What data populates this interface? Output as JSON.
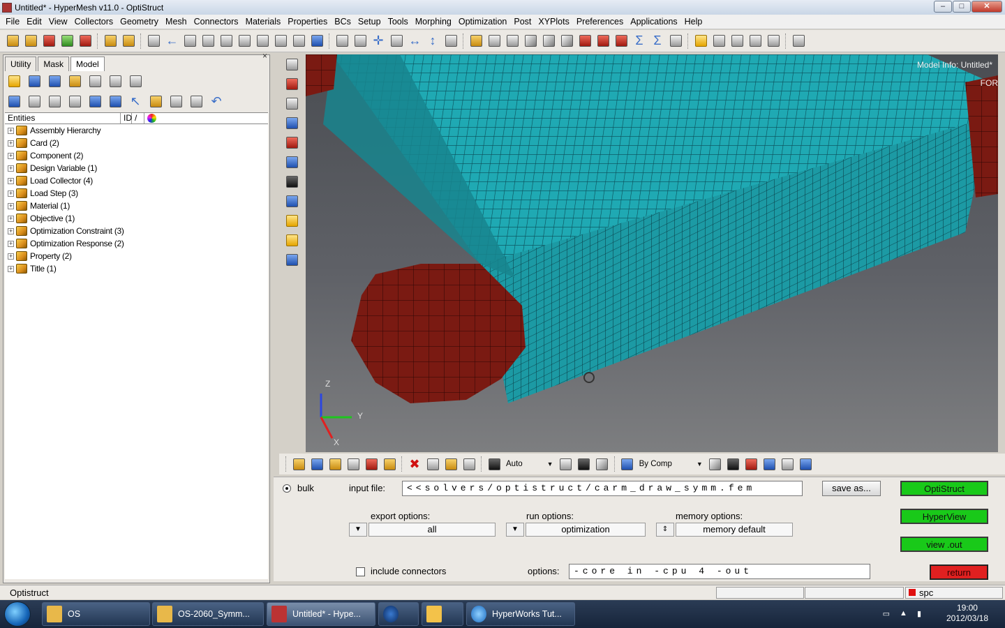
{
  "window": {
    "title": "Untitled* - HyperMesh v11.0 - OptiStruct",
    "minimize": "–",
    "maximize": "□",
    "close": "✕"
  },
  "menu": [
    "File",
    "Edit",
    "View",
    "Collectors",
    "Geometry",
    "Mesh",
    "Connectors",
    "Materials",
    "Properties",
    "BCs",
    "Setup",
    "Tools",
    "Morphing",
    "Optimization",
    "Post",
    "XYPlots",
    "Preferences",
    "Applications",
    "Help"
  ],
  "panel": {
    "close": "×",
    "tabs": [
      "Utility",
      "Mask",
      "Model"
    ],
    "columns": {
      "entities": "Entities",
      "id": "ID",
      "sort": "/"
    },
    "tree": [
      "Assembly Hierarchy",
      "Card (2)",
      "Component (2)",
      "Design Variable (1)",
      "Load Collector (4)",
      "Load Step (3)",
      "Material (1)",
      "Objective (1)",
      "Optimization Constraint (3)",
      "Optimization Response (2)",
      "Property (2)",
      "Title (1)"
    ],
    "expander": "+"
  },
  "viewport": {
    "model_info": "Model Info: Untitled*",
    "model_info_2": "FOR",
    "axis_labels": {
      "z": "Z",
      "y": "Y",
      "x": "X"
    },
    "mesh_colors": {
      "block": "#1fa9b3",
      "pin": "#7a1a12",
      "background": "#55585d"
    }
  },
  "toolbar2": {
    "auto": "Auto",
    "by_comp": "By Comp"
  },
  "solver": {
    "bulk_label": "bulk",
    "input_file_label": "input file:",
    "input_file_value": "<<solvers/optistruct/carm_draw_symm.fem",
    "save_as": "save as...",
    "export_label": "export options:",
    "export_value": "all",
    "run_label": "run options:",
    "run_value": "optimization",
    "memory_label": "memory options:",
    "memory_value": "memory default",
    "include_connectors": "include connectors",
    "options_label": "options:",
    "options_value": "-core in -cpu 4 -out",
    "buttons": {
      "optistruct": "OptiStruct",
      "hyperview": "HyperView",
      "view_out": "view .out",
      "return": "return"
    }
  },
  "status": {
    "left": "Optistruct",
    "right": "spc"
  },
  "taskbar": {
    "items": [
      "OS",
      "OS-2060_Symm...",
      "Untitled* - Hype...",
      "HyperWorks Tut..."
    ],
    "time": "19:00",
    "date": "2012/03/18"
  }
}
